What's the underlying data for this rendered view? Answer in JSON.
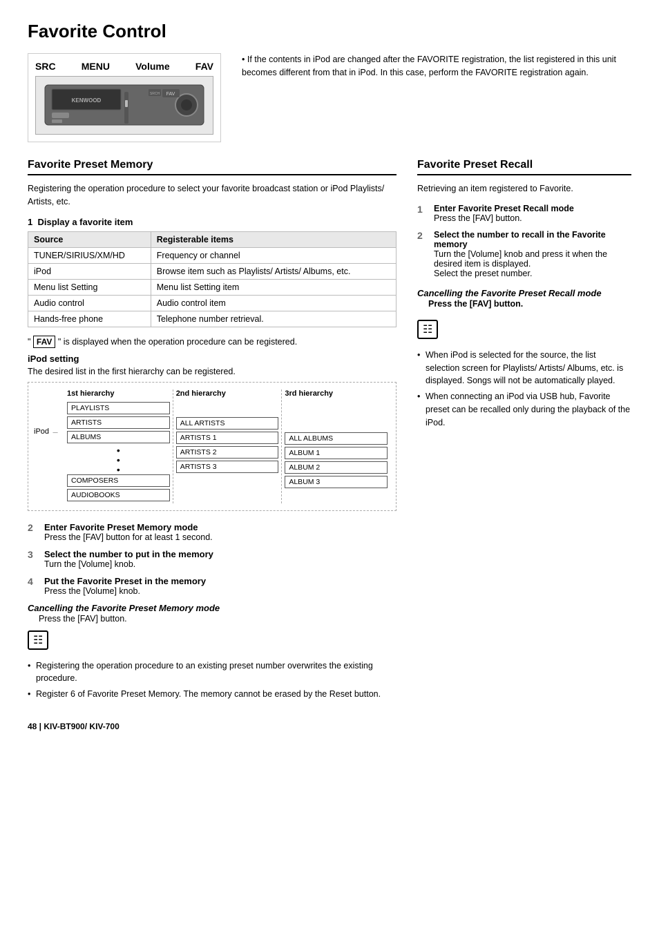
{
  "page": {
    "title": "Favorite Control",
    "footer": "48  |  KIV-BT900/ KIV-700"
  },
  "device": {
    "src_label": "SRC",
    "menu_label": "MENU",
    "volume_label": "Volume",
    "fav_label": "FAV",
    "kenwood_text": "KENWOOD"
  },
  "top_note": "If the contents in iPod are changed after the FAVORITE registration, the list registered in this unit becomes different from that in iPod. In this case, perform the FAVORITE registration again.",
  "favorite_preset_memory": {
    "section_title": "Favorite Preset Memory",
    "intro": "Registering the operation procedure to select your favorite broadcast station or iPod Playlists/ Artists, etc.",
    "step1": {
      "label": "1",
      "title": "Display a favorite item",
      "table": {
        "col1": "Source",
        "col2": "Registerable items",
        "rows": [
          [
            "TUNER/SIRIUS/XM/HD",
            "Frequency or channel"
          ],
          [
            "iPod",
            "Browse item such as Playlists/ Artists/ Albums, etc."
          ],
          [
            "Menu list Setting",
            "Menu list Setting item"
          ],
          [
            "Audio control",
            "Audio control item"
          ],
          [
            "Hands-free phone",
            "Telephone number retrieval."
          ]
        ]
      },
      "fav_note": "\" FAV \" is displayed when the operation procedure can be registered.",
      "ipod_setting_title": "iPod setting",
      "ipod_setting_desc": "The desired list in the first hierarchy can be registered.",
      "hierarchy": {
        "col1_title": "1st hierarchy",
        "col2_title": "2nd hierarchy",
        "col3_title": "3rd hierarchy",
        "ipod_label": "iPod",
        "col1_items": [
          "PLAYLISTS",
          "ARTISTS",
          "ALBUMS",
          "COMPOSERS",
          "AUDIOBOOKS"
        ],
        "col2_items": [
          "ALL ARTISTS",
          "ARTISTS 1",
          "ARTISTS 2",
          "ARTISTS 3"
        ],
        "col3_items": [
          "ALL ALBUMS",
          "ALBUM 1",
          "ALBUM 2",
          "ALBUM 3"
        ]
      }
    },
    "step2": {
      "label": "2",
      "title": "Enter Favorite Preset Memory mode",
      "desc": "Press the [FAV] button for at least 1 second."
    },
    "step3": {
      "label": "3",
      "title": "Select the number to put in the memory",
      "desc": "Turn the [Volume] knob."
    },
    "step4": {
      "label": "4",
      "title": "Put the Favorite Preset in the memory",
      "desc": "Press the [Volume] knob."
    },
    "cancel": {
      "title": "Cancelling the Favorite Preset Memory mode",
      "desc": "Press the [FAV] button."
    },
    "notes": [
      "Registering the operation procedure to an existing preset number overwrites the existing procedure.",
      "Register 6 of Favorite Preset Memory. The memory cannot be erased by the Reset button."
    ]
  },
  "favorite_preset_recall": {
    "section_title": "Favorite Preset Recall",
    "intro": "Retrieving an item registered to Favorite.",
    "step1": {
      "label": "1",
      "title": "Enter Favorite Preset Recall mode",
      "desc": "Press the [FAV] button."
    },
    "step2": {
      "label": "2",
      "title": "Select the number to recall in the Favorite memory",
      "desc": "Turn the [Volume] knob and press it when the desired item is displayed.\nSelect the preset number."
    },
    "cancel": {
      "title": "Cancelling the Favorite Preset Recall mode",
      "desc": "Press the [FAV] button."
    },
    "notes": [
      "When iPod is selected for the source, the list selection screen for Playlists/ Artists/ Albums, etc. is displayed. Songs will not be automatically played.",
      "When connecting an iPod via USB hub, Favorite preset can be recalled only during the playback of the iPod."
    ]
  }
}
